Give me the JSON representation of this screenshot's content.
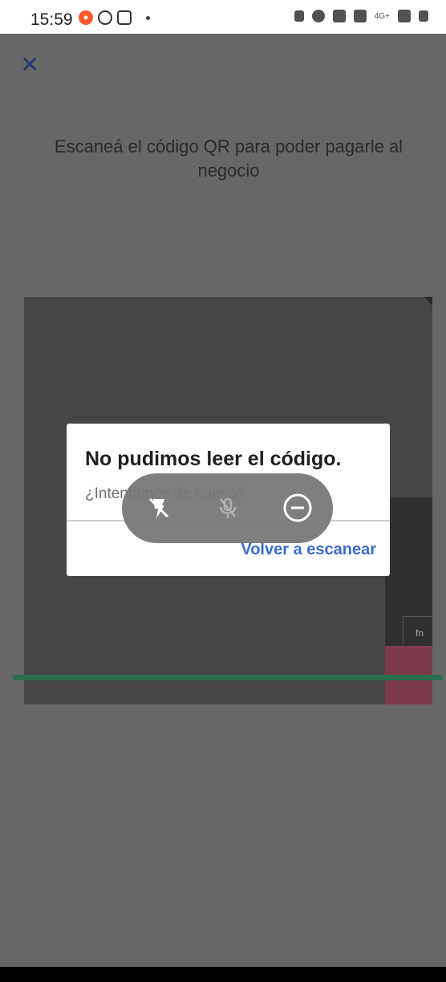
{
  "status_bar": {
    "time": "15:59",
    "network_label": "4G+"
  },
  "top": {
    "close_symbol": "✕"
  },
  "prompt": {
    "text": "Escaneá el código QR para poder pagarle al negocio"
  },
  "camera": {
    "visible_key_label": "fn"
  },
  "dialog": {
    "title": "No pudimos leer el código.",
    "subtitle": "¿Intentamos de nuevo?",
    "action_label": "Volver a escanear"
  },
  "colors": {
    "accent_blue": "#3a6ad7",
    "scan_line_green": "#2a6e4f",
    "close_icon_blue": "#213a73"
  }
}
